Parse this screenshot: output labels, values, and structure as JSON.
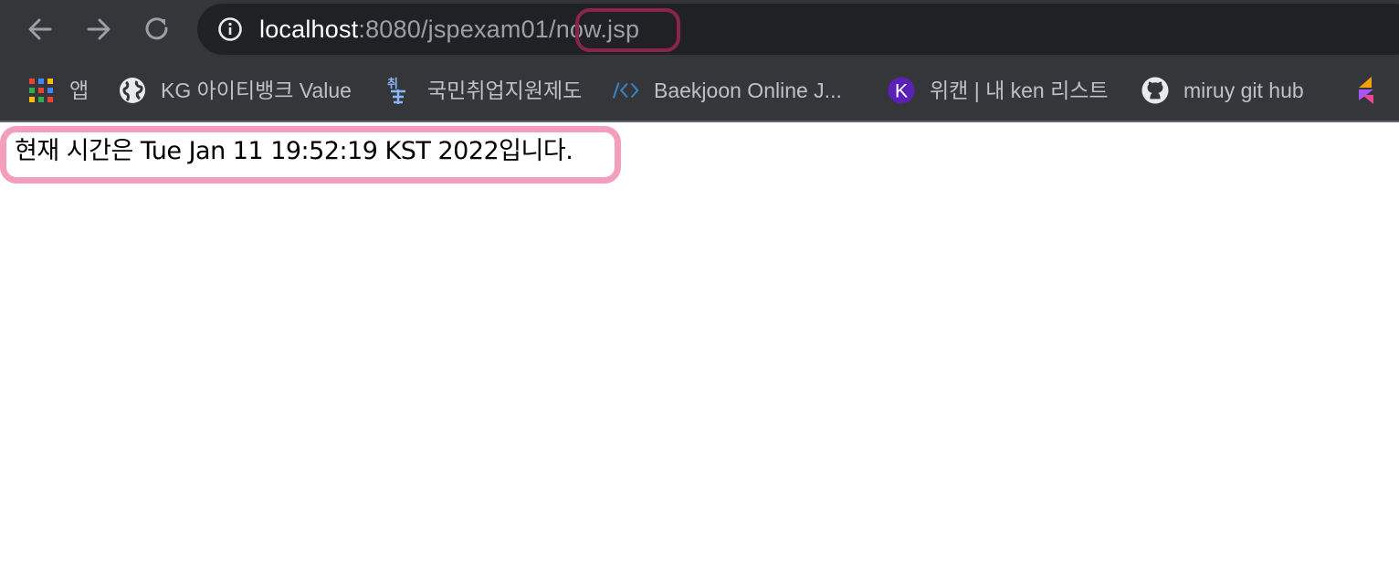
{
  "browser": {
    "url": {
      "host": "localhost",
      "path_prefix": ":8080/jspexam01/",
      "path_file": "now.jsp"
    },
    "highlight_color": "#8a2448",
    "chrome_background": "#35363a",
    "omnibox_background": "#202124"
  },
  "bookmarks": [
    {
      "icon": "apps-grid-icon",
      "label": "앱"
    },
    {
      "icon": "globe-icon",
      "label": "KG 아이티뱅크 Value"
    },
    {
      "icon": "site-logo-icon",
      "label": "국민취업지원제도"
    },
    {
      "icon": "code-brackets-icon",
      "label": "Baekjoon Online J..."
    },
    {
      "icon": "k-circle-icon",
      "label": "위캔 | 내 ken 리스트"
    },
    {
      "icon": "github-icon",
      "label": "miruy git hub"
    },
    {
      "icon": "bookmark-logo-icon",
      "label": ""
    }
  ],
  "page": {
    "message": "현재 시간은 Tue Jan 11 19:52:19 KST 2022입니다.",
    "highlight_color": "#f49ebd"
  }
}
